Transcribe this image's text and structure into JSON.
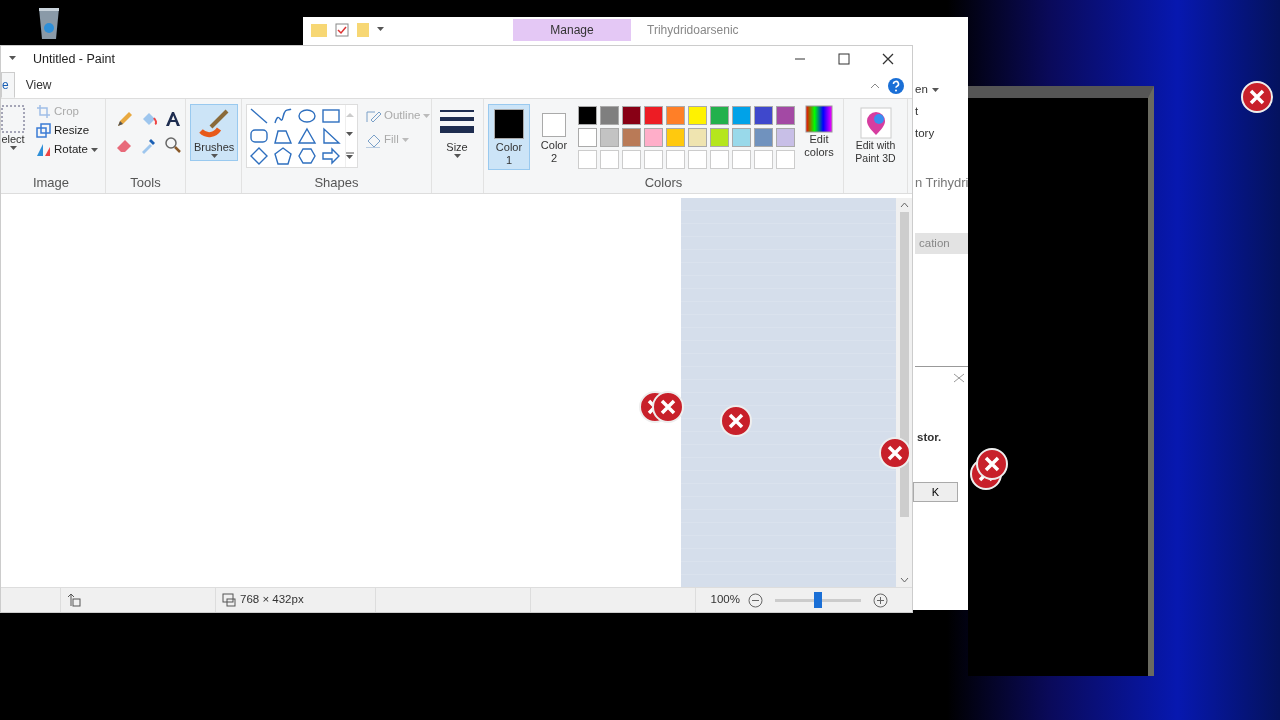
{
  "explorer": {
    "contextual_tab": "Manage",
    "title": "Trihydridoarsenic",
    "fragments": [
      {
        "text": "en",
        "menu": true
      },
      {
        "text": "t",
        "menu": false
      },
      {
        "text": "tory",
        "menu": false
      }
    ],
    "address": "n Trihydri",
    "column": "cation",
    "dialog_text": "stor.",
    "dialog_button": "K"
  },
  "paint": {
    "title": "Untitled - Paint",
    "tabs": [
      {
        "label": "e",
        "selected": true
      },
      {
        "label": "View",
        "selected": false
      }
    ],
    "image_group": {
      "label": "Image",
      "select_label": "elect",
      "tools": [
        {
          "label": "Crop",
          "disabled": true,
          "menu": false
        },
        {
          "label": "Resize",
          "disabled": false,
          "menu": false
        },
        {
          "label": "Rotate",
          "disabled": false,
          "menu": true
        }
      ]
    },
    "tools_group": {
      "label": "Tools"
    },
    "brushes": {
      "label": "Brushes",
      "selected": true
    },
    "shapes_group": {
      "label": "Shapes",
      "options": [
        {
          "label": "Outline",
          "disabled": true
        },
        {
          "label": "Fill",
          "disabled": true
        }
      ]
    },
    "size": {
      "label": "Size"
    },
    "colors_group": {
      "label": "Colors",
      "edit_label": "Edit colors",
      "current": [
        {
          "label": "Color 1",
          "color": "#000000",
          "selected": true
        },
        {
          "label": "Color 2",
          "color": "#ffffff",
          "selected": false
        }
      ],
      "palette": [
        {
          "color": "#000000"
        },
        {
          "color": "#7f7f7f"
        },
        {
          "color": "#880015"
        },
        {
          "color": "#ed1c24"
        },
        {
          "color": "#ff7f27"
        },
        {
          "color": "#fff200"
        },
        {
          "color": "#22b14c"
        },
        {
          "color": "#00a2e8"
        },
        {
          "color": "#3f48cc"
        },
        {
          "color": "#a349a4"
        },
        {
          "color": "#ffffff"
        },
        {
          "color": "#c3c3c3"
        },
        {
          "color": "#b97a57"
        },
        {
          "color": "#ffaec9"
        },
        {
          "color": "#ffc90e"
        },
        {
          "color": "#efe4b0"
        },
        {
          "color": "#b5e61d"
        },
        {
          "color": "#99d9ea"
        },
        {
          "color": "#7092be"
        },
        {
          "color": "#c8bfe7"
        }
      ]
    },
    "paint3d": {
      "label": "Edit with Paint 3D"
    },
    "status": {
      "dimensions": "768 × 432px",
      "zoom": "100%",
      "level": 0.5
    }
  }
}
